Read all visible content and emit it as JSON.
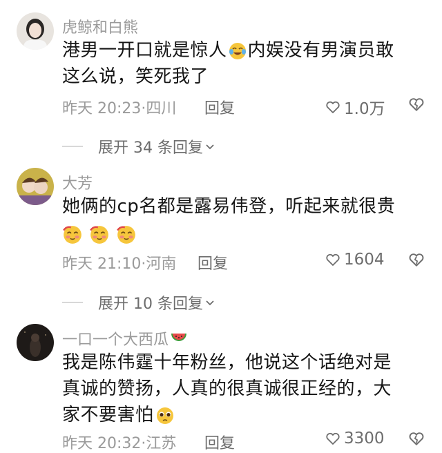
{
  "comments": [
    {
      "username": "虎鲸和白熊",
      "lines": [
        "港男一开口就是惊人",
        "内娱没有男演员敢",
        "这么说，笑死我了"
      ],
      "meta": "昨天 20:23·四川",
      "reply_label": "回复",
      "likes": "1.0万",
      "expand_label": "展开 34 条回复"
    },
    {
      "username": "大芳",
      "lines": [
        "她俩的cp名都是露易伟登，听起来就很贵"
      ],
      "meta": "昨天 21:10·河南",
      "reply_label": "回复",
      "likes": "1604",
      "expand_label": "展开 10 条回复"
    },
    {
      "username": "一口一个大西瓜",
      "lines": [
        "我是陈伟霆十年粉丝，他说这个话绝对是",
        "真诚的赞扬，人真的很真诚很正经的，大",
        "家不要害怕"
      ],
      "meta": "昨天 20:32·江苏",
      "reply_label": "回复",
      "likes": "3300"
    }
  ],
  "icons": {
    "like": "heart-outline-icon",
    "dislike": "broken-heart-icon",
    "expand": "chevron-down-icon",
    "emoji_cry_laugh": "tears-of-joy-emoji",
    "emoji_blush": "blushing-emoji",
    "emoji_pleading": "pleading-emoji",
    "emoji_watermelon": "watermelon-emoji"
  },
  "colors": {
    "username": "#9a9a9a",
    "text": "#161616",
    "secondary": "#6d6d6d"
  }
}
